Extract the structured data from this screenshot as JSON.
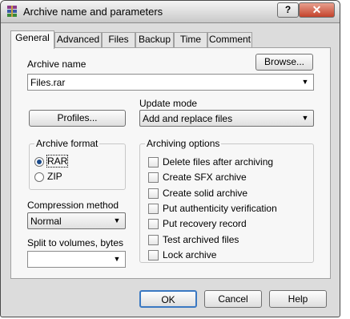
{
  "window": {
    "title": "Archive name and parameters",
    "help_label": "?",
    "close_label": "✕"
  },
  "tabs": [
    "General",
    "Advanced",
    "Files",
    "Backup",
    "Time",
    "Comment"
  ],
  "general": {
    "archive_name_label": "Archive name",
    "archive_name_value": "Files.rar",
    "browse_label": "Browse...",
    "profiles_label": "Profiles...",
    "update_mode_label": "Update mode",
    "update_mode_value": "Add and replace files",
    "archive_format": {
      "title": "Archive format",
      "options": [
        "RAR",
        "ZIP"
      ],
      "selected": "RAR"
    },
    "compression_label": "Compression method",
    "compression_value": "Normal",
    "split_label": "Split to volumes, bytes",
    "split_value": "",
    "archiving_options": {
      "title": "Archiving options",
      "items": [
        "Delete files after archiving",
        "Create SFX archive",
        "Create solid archive",
        "Put authenticity verification",
        "Put recovery record",
        "Test archived files",
        "Lock archive"
      ]
    }
  },
  "footer": {
    "ok_label": "OK",
    "cancel_label": "Cancel",
    "help_label": "Help"
  }
}
